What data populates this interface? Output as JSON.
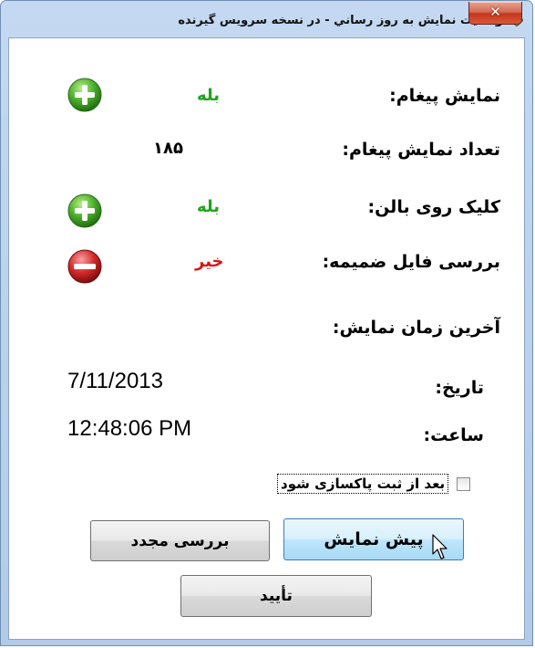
{
  "window": {
    "title": "وضعيت نمايش به روز رساني - در نسخه سرويس گيرنده",
    "close_glyph": "✕"
  },
  "fields": {
    "show_message": {
      "label": "نمایش پیغام:",
      "value": "بله",
      "value_color": "#1aa71a",
      "icon": "plus-icon"
    },
    "message_count": {
      "label": "تعداد نمایش پیغام:",
      "value": "۱۸۵"
    },
    "balloon_click": {
      "label": "کلیک روی بالن:",
      "value": "بله",
      "value_color": "#1aa71a",
      "icon": "plus-icon"
    },
    "attachment_check": {
      "label": "بررسی فایل ضمیمه:",
      "value": "خیر",
      "value_color": "#e01010",
      "icon": "minus-icon"
    }
  },
  "last_display": {
    "heading": "آخرین زمان نمایش:",
    "date_label": "تاریخ:",
    "date_value": "7/11/2013",
    "time_label": "ساعت:",
    "time_value": "12:48:06 PM"
  },
  "checkbox": {
    "label": "بعد از ثبت پاکسازی شود",
    "checked": false
  },
  "buttons": {
    "preview": "پیش نمایش",
    "recheck": "بررسی مجدد",
    "confirm": "تأیید"
  }
}
